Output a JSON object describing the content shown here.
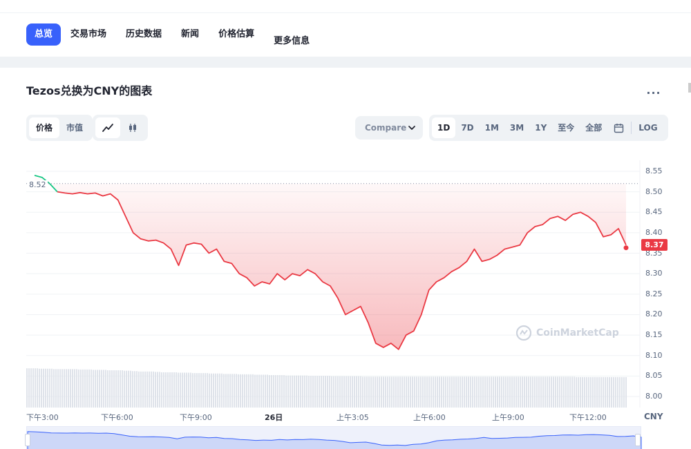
{
  "nav": {
    "tabs": [
      {
        "label": "总览",
        "active": true
      },
      {
        "label": "交易市场",
        "active": false
      },
      {
        "label": "历史数据",
        "active": false
      },
      {
        "label": "新闻",
        "active": false
      },
      {
        "label": "价格估算",
        "active": false
      },
      {
        "label": "更多信息",
        "active": false
      }
    ]
  },
  "chart_header": {
    "title": "Tezos兑换为CNY的图表",
    "more_icon": "ellipsis-icon",
    "more_label": "..."
  },
  "controls": {
    "metric": [
      "价格",
      "市值"
    ],
    "metric_active": "价格",
    "chart_type_icons": [
      "line-chart-icon",
      "candlestick-icon"
    ],
    "compare_label": "Compare",
    "ranges": [
      "1D",
      "7D",
      "1M",
      "3M",
      "1Y",
      "至今",
      "全部"
    ],
    "range_active": "1D",
    "calendar_icon": "calendar-icon",
    "log_label": "LOG"
  },
  "colors": {
    "accent": "#3861fb",
    "down": "#ea3943",
    "up": "#16c784"
  },
  "chart_data": {
    "type": "line",
    "currency": "CNY",
    "open_price": "8.52",
    "current_price": "8.37",
    "ylim": [
      7.98,
      8.57
    ],
    "yticks": [
      "8.55",
      "8.50",
      "8.45",
      "8.40",
      "8.35",
      "8.30",
      "8.25",
      "8.20",
      "8.15",
      "8.10",
      "8.05",
      "8.00"
    ],
    "xticks": [
      "下午3:00",
      "下午6:00",
      "下午9:00",
      "26日",
      "上午3:05",
      "上午6:00",
      "上午9:00",
      "下午12:00"
    ],
    "x": [
      0,
      0.3,
      0.6,
      0.9,
      1.2,
      1.5,
      1.8,
      2.1,
      2.4,
      2.7,
      3.0,
      3.3,
      3.6,
      3.9,
      4.2,
      4.5,
      4.8,
      5.1,
      5.4,
      5.7,
      6.0,
      6.3,
      6.6,
      6.9,
      7.2,
      7.5,
      7.8,
      8.1,
      8.4,
      8.7,
      9.0,
      9.3,
      9.6,
      9.9,
      10.2,
      10.5,
      10.8,
      11.1,
      11.4,
      11.7,
      12.0,
      12.3,
      12.6,
      12.9,
      13.2,
      13.5,
      13.8,
      14.1,
      14.4,
      14.7,
      15.0,
      15.3,
      15.6,
      15.9,
      16.2,
      16.5,
      16.8,
      17.1,
      17.4,
      17.7,
      18.0,
      18.3,
      18.6,
      18.9,
      19.2,
      19.5,
      19.8,
      20.1,
      20.4,
      20.7,
      21.0,
      21.3,
      21.6,
      21.9,
      22.2,
      22.5,
      22.8,
      23.1,
      23.4
    ],
    "values": [
      8.54,
      8.535,
      8.52,
      8.5,
      8.497,
      8.495,
      8.498,
      8.495,
      8.497,
      8.49,
      8.495,
      8.48,
      8.44,
      8.4,
      8.385,
      8.38,
      8.382,
      8.375,
      8.36,
      8.32,
      8.37,
      8.375,
      8.372,
      8.35,
      8.36,
      8.33,
      8.325,
      8.3,
      8.29,
      8.27,
      8.28,
      8.275,
      8.3,
      8.285,
      8.3,
      8.295,
      8.31,
      8.3,
      8.28,
      8.27,
      8.24,
      8.2,
      8.21,
      8.22,
      8.18,
      8.13,
      8.12,
      8.13,
      8.115,
      8.15,
      8.16,
      8.2,
      8.26,
      8.28,
      8.29,
      8.305,
      8.315,
      8.33,
      8.36,
      8.33,
      8.335,
      8.345,
      8.36,
      8.365,
      8.37,
      8.4,
      8.415,
      8.42,
      8.435,
      8.44,
      8.43,
      8.445,
      8.45,
      8.44,
      8.425,
      8.39,
      8.395,
      8.41,
      8.37
    ],
    "volume_relative": [
      0.98,
      0.98,
      0.97,
      0.97,
      0.96,
      0.96,
      0.96,
      0.95,
      0.95,
      0.94,
      0.94,
      0.93,
      0.93,
      0.92,
      0.91,
      0.9,
      0.9,
      0.89,
      0.88,
      0.88,
      0.87,
      0.87,
      0.86,
      0.86,
      0.85,
      0.85,
      0.84,
      0.84,
      0.83,
      0.83,
      0.82,
      0.82,
      0.81,
      0.81,
      0.8,
      0.8,
      0.8,
      0.79,
      0.79,
      0.79,
      0.78,
      0.78,
      0.78,
      0.78,
      0.77,
      0.77,
      0.77,
      0.77,
      0.77,
      0.77,
      0.77,
      0.77,
      0.77,
      0.77,
      0.77,
      0.77,
      0.77,
      0.77,
      0.77,
      0.77,
      0.77,
      0.77,
      0.77,
      0.77,
      0.77,
      0.77,
      0.77,
      0.77,
      0.77,
      0.77,
      0.77,
      0.77,
      0.76,
      0.76,
      0.76,
      0.76,
      0.76,
      0.76,
      0.76
    ],
    "grid": true,
    "watermark": "CoinMarketCap"
  }
}
